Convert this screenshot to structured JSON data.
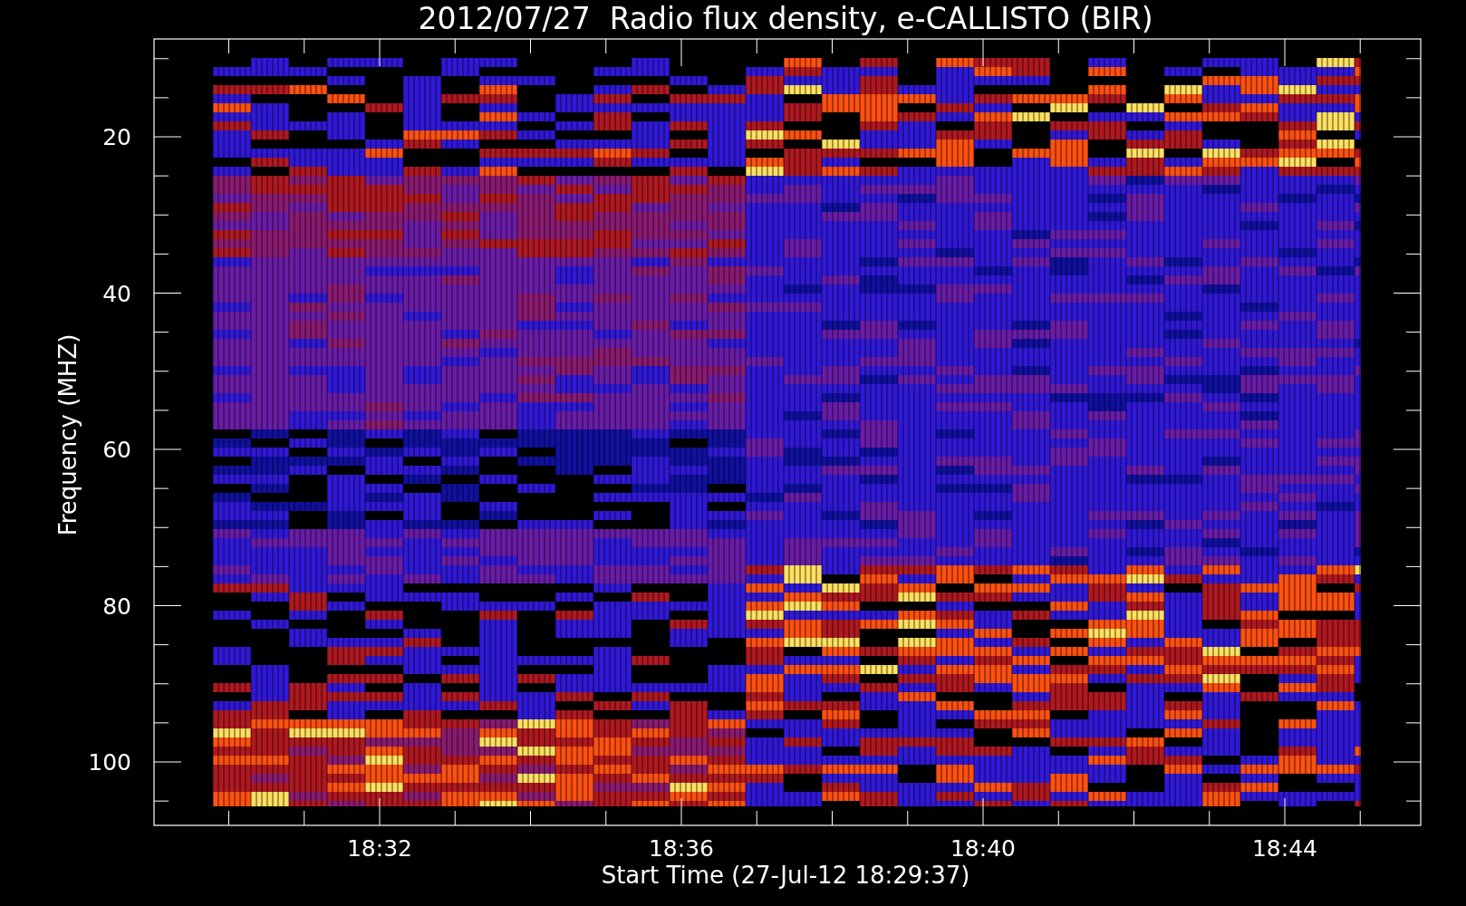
{
  "plot": {
    "title": "2012/07/27  Radio flux density, e-CALLISTO (BIR)",
    "xlabel": "Start Time (27-Jul-12 18:29:37)",
    "ylabel": "Frequency (MHZ)",
    "yticks": [
      "20",
      "40",
      "60",
      "80",
      "100"
    ],
    "xticks": [
      "18:32",
      "18:36",
      "18:40",
      "18:44"
    ]
  }
}
